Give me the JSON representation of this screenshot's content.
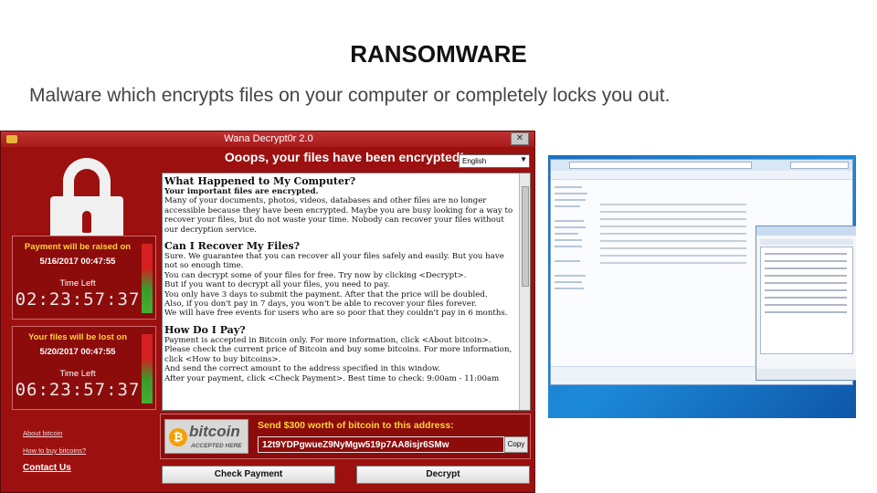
{
  "slide": {
    "title": "RANSOMWARE",
    "subtitle": "Malware which encrypts files on your computer or completely locks you out."
  },
  "wannacry": {
    "window_title": "Wana Decrypt0r 2.0",
    "close_label": "✕",
    "heading": "Ooops, your files have been encrypted!",
    "language": "English",
    "timer1": {
      "heading": "Payment will be raised on",
      "date": "5/16/2017 00:47:55",
      "time_left_label": "Time Left",
      "countdown": "02:23:57:37"
    },
    "timer2": {
      "heading": "Your files will be lost on",
      "date": "5/20/2017 00:47:55",
      "time_left_label": "Time Left",
      "countdown": "06:23:57:37"
    },
    "links": {
      "about": "About bitcoin",
      "how_to_buy": "How to buy bitcoins?",
      "contact": "Contact Us"
    },
    "message": {
      "s1_title": "What Happened to My Computer?",
      "s1_lines": [
        "Your important files are encrypted.",
        "Many of your documents, photos, videos, databases and other files are no longer",
        "accessible because they have been encrypted. Maybe you are busy looking for a way to",
        "recover your files, but do not waste your time. Nobody can recover your files without",
        "our decryption service."
      ],
      "s2_title": "Can I Recover My Files?",
      "s2_lines": [
        "Sure. We guarantee that you can recover all your files safely and easily. But you have",
        "not so enough time.",
        "You can decrypt some of your files for free. Try now by clicking <Decrypt>.",
        "But if you want to decrypt all your files, you need to pay.",
        "You only have 3 days to submit the payment. After that the price will be doubled.",
        "Also, if you don't pay in 7 days, you won't be able to recover your files forever.",
        "We will have free events for users who are so poor that they couldn't pay in 6 months."
      ],
      "s3_title": "How Do I Pay?",
      "s3_lines": [
        "Payment is accepted in Bitcoin only. For more information, click <About bitcoin>.",
        "Please check the current price of Bitcoin and buy some bitcoins. For more information,",
        "click <How to buy bitcoins>.",
        "And send the correct amount to the address specified in this window.",
        "After your payment, click <Check Payment>. Best time to check: 9:00am - 11:00am"
      ]
    },
    "bitcoin": {
      "coin": "₿",
      "word": "bitcoin",
      "accepted": "ACCEPTED HERE"
    },
    "pay_label": "Send $300 worth of bitcoin to this address:",
    "address": "12t9YDPgwueZ9NyMgw519p7AA8isjr6SMw",
    "copy_label": "Copy",
    "check_payment_label": "Check Payment",
    "decrypt_label": "Decrypt"
  }
}
